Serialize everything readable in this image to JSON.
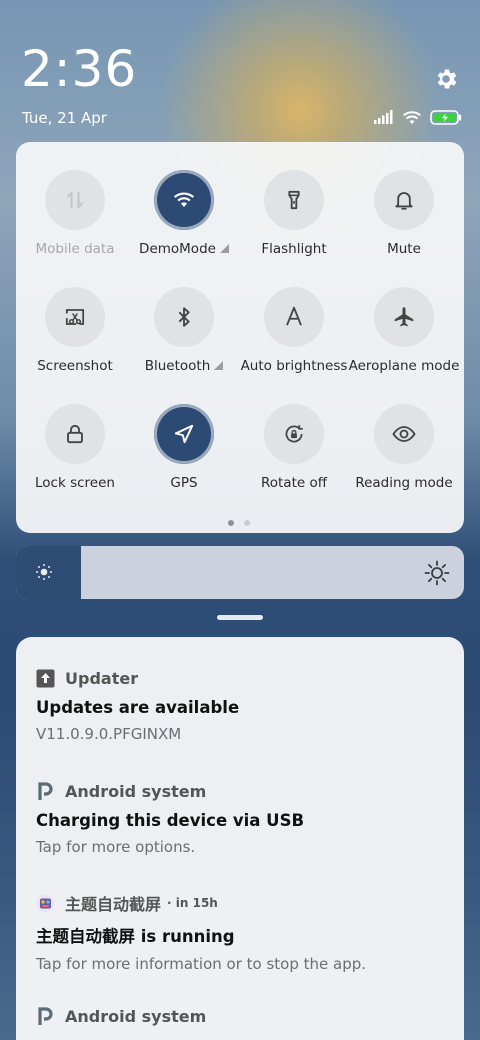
{
  "status": {
    "time": "2:36",
    "date": "Tue, 21 Apr",
    "icons": [
      "signal-icon",
      "wifi-icon",
      "battery-charging-icon"
    ],
    "settings_icon": "gear-icon"
  },
  "quick_settings": {
    "tiles": [
      {
        "label": "Mobile data",
        "icon": "mobile-data-icon",
        "active": false,
        "disabled": true,
        "has_more": false
      },
      {
        "label": "DemoMode",
        "icon": "wifi-icon",
        "active": true,
        "disabled": false,
        "has_more": true
      },
      {
        "label": "Flashlight",
        "icon": "flashlight-icon",
        "active": false,
        "disabled": false,
        "has_more": false
      },
      {
        "label": "Mute",
        "icon": "bell-icon",
        "active": false,
        "disabled": false,
        "has_more": false
      },
      {
        "label": "Screenshot",
        "icon": "screenshot-icon",
        "active": false,
        "disabled": false,
        "has_more": false
      },
      {
        "label": "Bluetooth",
        "icon": "bluetooth-icon",
        "active": false,
        "disabled": false,
        "has_more": true
      },
      {
        "label": "Auto brightness",
        "icon": "auto-brightness-icon",
        "active": false,
        "disabled": false,
        "has_more": false
      },
      {
        "label": "Aeroplane mode",
        "icon": "airplane-icon",
        "active": false,
        "disabled": false,
        "has_more": false
      },
      {
        "label": "Lock screen",
        "icon": "lock-icon",
        "active": false,
        "disabled": false,
        "has_more": false
      },
      {
        "label": "GPS",
        "icon": "location-icon",
        "active": true,
        "disabled": false,
        "has_more": false
      },
      {
        "label": "Rotate off",
        "icon": "rotate-lock-icon",
        "active": false,
        "disabled": false,
        "has_more": false
      },
      {
        "label": "Reading mode",
        "icon": "eye-icon",
        "active": false,
        "disabled": false,
        "has_more": false
      }
    ],
    "pages": 2,
    "current_page": 1
  },
  "brightness": {
    "level": 0.145,
    "low_icon": "brightness-low-icon",
    "high_icon": "brightness-high-icon",
    "fill_color": "#2f4c74"
  },
  "notifications": [
    {
      "app": "Updater",
      "time": "",
      "icon": "updater-icon",
      "title": "Updates are available",
      "text": "V11.0.9.0.PFGINXM"
    },
    {
      "app": "Android system",
      "time": "",
      "icon": "android-system-icon",
      "title": "Charging this device via USB",
      "text": "Tap for more options."
    },
    {
      "app": "主题自动截屏",
      "time": "in 15h",
      "icon": "theme-app-icon",
      "title": "主题自动截屏 is running",
      "text": "Tap for more information or to stop the app."
    },
    {
      "app": "Android system",
      "time": "",
      "icon": "android-system-icon",
      "title": "",
      "text": ""
    }
  ]
}
